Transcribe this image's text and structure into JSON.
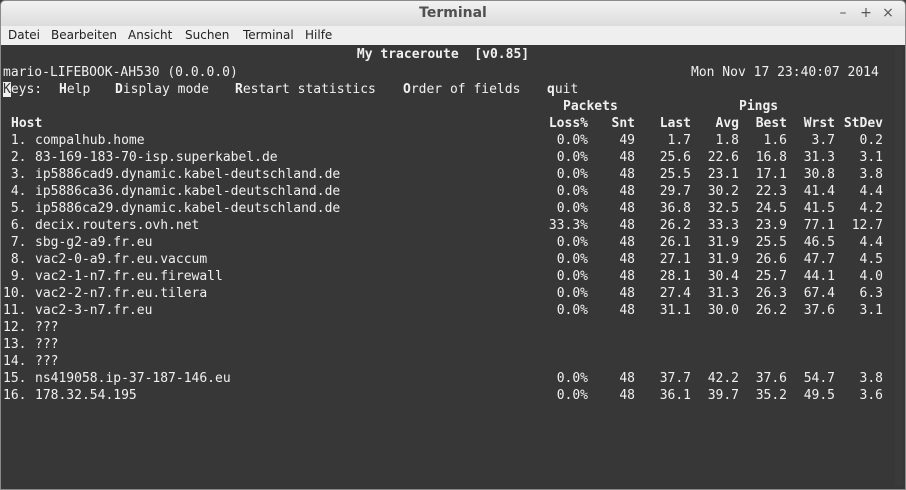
{
  "window": {
    "title": "Terminal",
    "minimize": "–",
    "maximize": "+",
    "close": "×"
  },
  "menu": [
    "Datei",
    "Bearbeiten",
    "Ansicht",
    "Suchen",
    "Terminal",
    "Hilfe"
  ],
  "mtr": {
    "title": "My traceroute  [v0.85]",
    "host_info": "mario-LIFEBOOK-AH530 (0.0.0.0)",
    "datetime": "Mon Nov 17 23:40:07 2014",
    "keys": {
      "label_key": "K",
      "label_rest": "eys:",
      "items": [
        {
          "key": "H",
          "rest": "elp"
        },
        {
          "key": "D",
          "rest": "isplay mode"
        },
        {
          "key": "R",
          "rest": "estart statistics"
        },
        {
          "key": "O",
          "rest": "rder of fields"
        },
        {
          "key": "q",
          "rest": "uit"
        }
      ]
    },
    "group_headers": {
      "packets": "Packets",
      "pings": "Pings"
    },
    "columns": {
      "host": "Host",
      "loss": "Loss%",
      "snt": "Snt",
      "last": "Last",
      "avg": "Avg",
      "best": "Best",
      "wrst": "Wrst",
      "stdev": "StDev"
    },
    "rows": [
      {
        "n": " 1.",
        "host": "compalhub.home",
        "loss": "0.0%",
        "snt": "49",
        "last": "1.7",
        "avg": "1.8",
        "best": "1.6",
        "wrst": "3.7",
        "stdev": "0.2"
      },
      {
        "n": " 2.",
        "host": "83-169-183-70-isp.superkabel.de",
        "loss": "0.0%",
        "snt": "48",
        "last": "25.6",
        "avg": "22.6",
        "best": "16.8",
        "wrst": "31.3",
        "stdev": "3.1"
      },
      {
        "n": " 3.",
        "host": "ip5886cad9.dynamic.kabel-deutschland.de",
        "loss": "0.0%",
        "snt": "48",
        "last": "25.5",
        "avg": "23.1",
        "best": "17.1",
        "wrst": "30.8",
        "stdev": "3.8"
      },
      {
        "n": " 4.",
        "host": "ip5886ca36.dynamic.kabel-deutschland.de",
        "loss": "0.0%",
        "snt": "48",
        "last": "29.7",
        "avg": "30.2",
        "best": "22.3",
        "wrst": "41.4",
        "stdev": "4.4"
      },
      {
        "n": " 5.",
        "host": "ip5886ca29.dynamic.kabel-deutschland.de",
        "loss": "0.0%",
        "snt": "48",
        "last": "36.8",
        "avg": "32.5",
        "best": "24.5",
        "wrst": "41.5",
        "stdev": "4.2"
      },
      {
        "n": " 6.",
        "host": "decix.routers.ovh.net",
        "loss": "33.3%",
        "snt": "48",
        "last": "26.2",
        "avg": "33.3",
        "best": "23.9",
        "wrst": "77.1",
        "stdev": "12.7"
      },
      {
        "n": " 7.",
        "host": "sbg-g2-a9.fr.eu",
        "loss": "0.0%",
        "snt": "48",
        "last": "26.1",
        "avg": "31.9",
        "best": "25.5",
        "wrst": "46.5",
        "stdev": "4.4"
      },
      {
        "n": " 8.",
        "host": "vac2-0-a9.fr.eu.vaccum",
        "loss": "0.0%",
        "snt": "48",
        "last": "27.1",
        "avg": "31.9",
        "best": "26.6",
        "wrst": "47.7",
        "stdev": "4.5"
      },
      {
        "n": " 9.",
        "host": "vac2-1-n7.fr.eu.firewall",
        "loss": "0.0%",
        "snt": "48",
        "last": "28.1",
        "avg": "30.4",
        "best": "25.7",
        "wrst": "44.1",
        "stdev": "4.0"
      },
      {
        "n": "10.",
        "host": "vac2-2-n7.fr.eu.tilera",
        "loss": "0.0%",
        "snt": "48",
        "last": "27.4",
        "avg": "31.3",
        "best": "26.3",
        "wrst": "67.4",
        "stdev": "6.3"
      },
      {
        "n": "11.",
        "host": "vac2-3-n7.fr.eu",
        "loss": "0.0%",
        "snt": "48",
        "last": "31.1",
        "avg": "30.0",
        "best": "26.2",
        "wrst": "37.6",
        "stdev": "3.1"
      },
      {
        "n": "12.",
        "host": "???",
        "loss": "",
        "snt": "",
        "last": "",
        "avg": "",
        "best": "",
        "wrst": "",
        "stdev": ""
      },
      {
        "n": "13.",
        "host": "???",
        "loss": "",
        "snt": "",
        "last": "",
        "avg": "",
        "best": "",
        "wrst": "",
        "stdev": ""
      },
      {
        "n": "14.",
        "host": "???",
        "loss": "",
        "snt": "",
        "last": "",
        "avg": "",
        "best": "",
        "wrst": "",
        "stdev": ""
      },
      {
        "n": "15.",
        "host": "ns419058.ip-37-187-146.eu",
        "loss": "0.0%",
        "snt": "48",
        "last": "37.7",
        "avg": "42.2",
        "best": "37.6",
        "wrst": "54.7",
        "stdev": "3.8"
      },
      {
        "n": "16.",
        "host": "178.32.54.195",
        "loss": "0.0%",
        "snt": "48",
        "last": "36.1",
        "avg": "39.7",
        "best": "35.2",
        "wrst": "49.5",
        "stdev": "3.6"
      }
    ]
  }
}
